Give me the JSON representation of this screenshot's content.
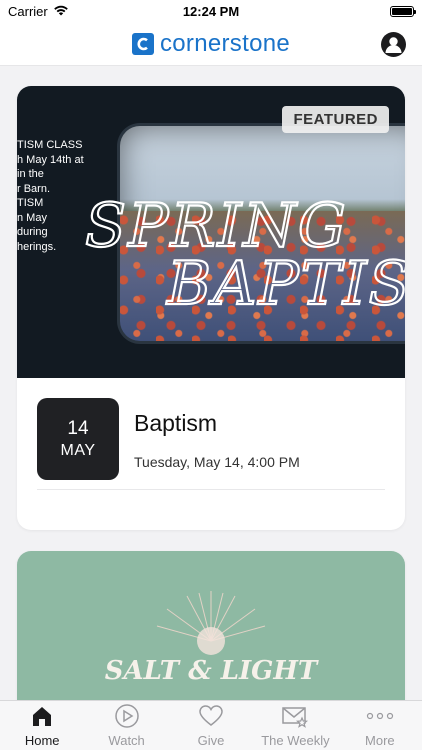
{
  "status_bar": {
    "carrier": "Carrier",
    "time": "12:24 PM"
  },
  "header": {
    "brand": "cornerstone",
    "brand_color": "#1a73c9"
  },
  "featured_card": {
    "badge": "FEATURED",
    "poster": {
      "title_line_1": "SPRING",
      "title_line_2": "BAPTISM",
      "side_text": [
        "TISM CLASS",
        "h May 14th at",
        "in the",
        "r Barn.",
        "",
        "TISM",
        "n May",
        "during",
        "herings."
      ]
    },
    "event": {
      "day": "14",
      "month": "MAY",
      "title": "Baptism",
      "datetime": "Tuesday, May 14, 4:00 PM"
    }
  },
  "second_card": {
    "title": "SALT & LIGHT",
    "background": "#8eb9a3"
  },
  "tabs": [
    {
      "label": "Home",
      "icon": "home-icon",
      "active": true
    },
    {
      "label": "Watch",
      "icon": "play-icon",
      "active": false
    },
    {
      "label": "Give",
      "icon": "heart-icon",
      "active": false
    },
    {
      "label": "The Weekly",
      "icon": "mail-star-icon",
      "active": false
    },
    {
      "label": "More",
      "icon": "more-icon",
      "active": false
    }
  ]
}
